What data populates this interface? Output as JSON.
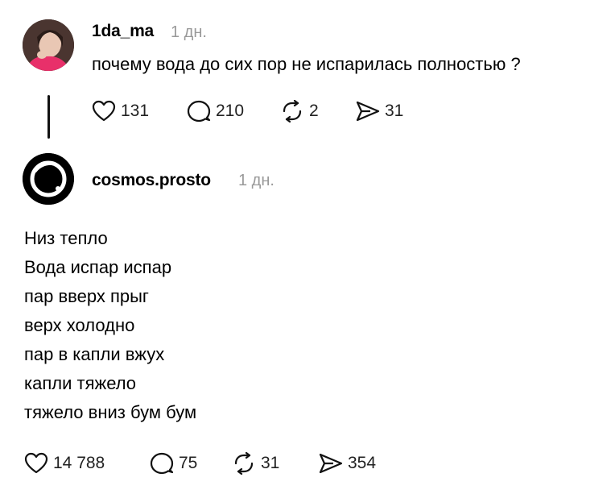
{
  "post1": {
    "username": "1da_ma",
    "time": "1 дн.",
    "text": "почему вода до сих пор не испарилась полностью ?",
    "likes": "131",
    "comments": "210",
    "reposts": "2",
    "shares": "31"
  },
  "post2": {
    "username": "cosmos.prosto",
    "time": "1 дн.",
    "lines": [
      "Низ тепло",
      "Вода испар испар",
      "пар вверх прыг",
      "верх холодно",
      "пар в капли вжух",
      "капли тяжело",
      "тяжело вниз бум бум"
    ],
    "likes": "14 788",
    "comments": "75",
    "reposts": "31",
    "shares": "354"
  },
  "icons": {
    "like": "heart-icon",
    "comment": "comment-bubble-icon",
    "repost": "repost-icon",
    "share": "send-icon"
  }
}
